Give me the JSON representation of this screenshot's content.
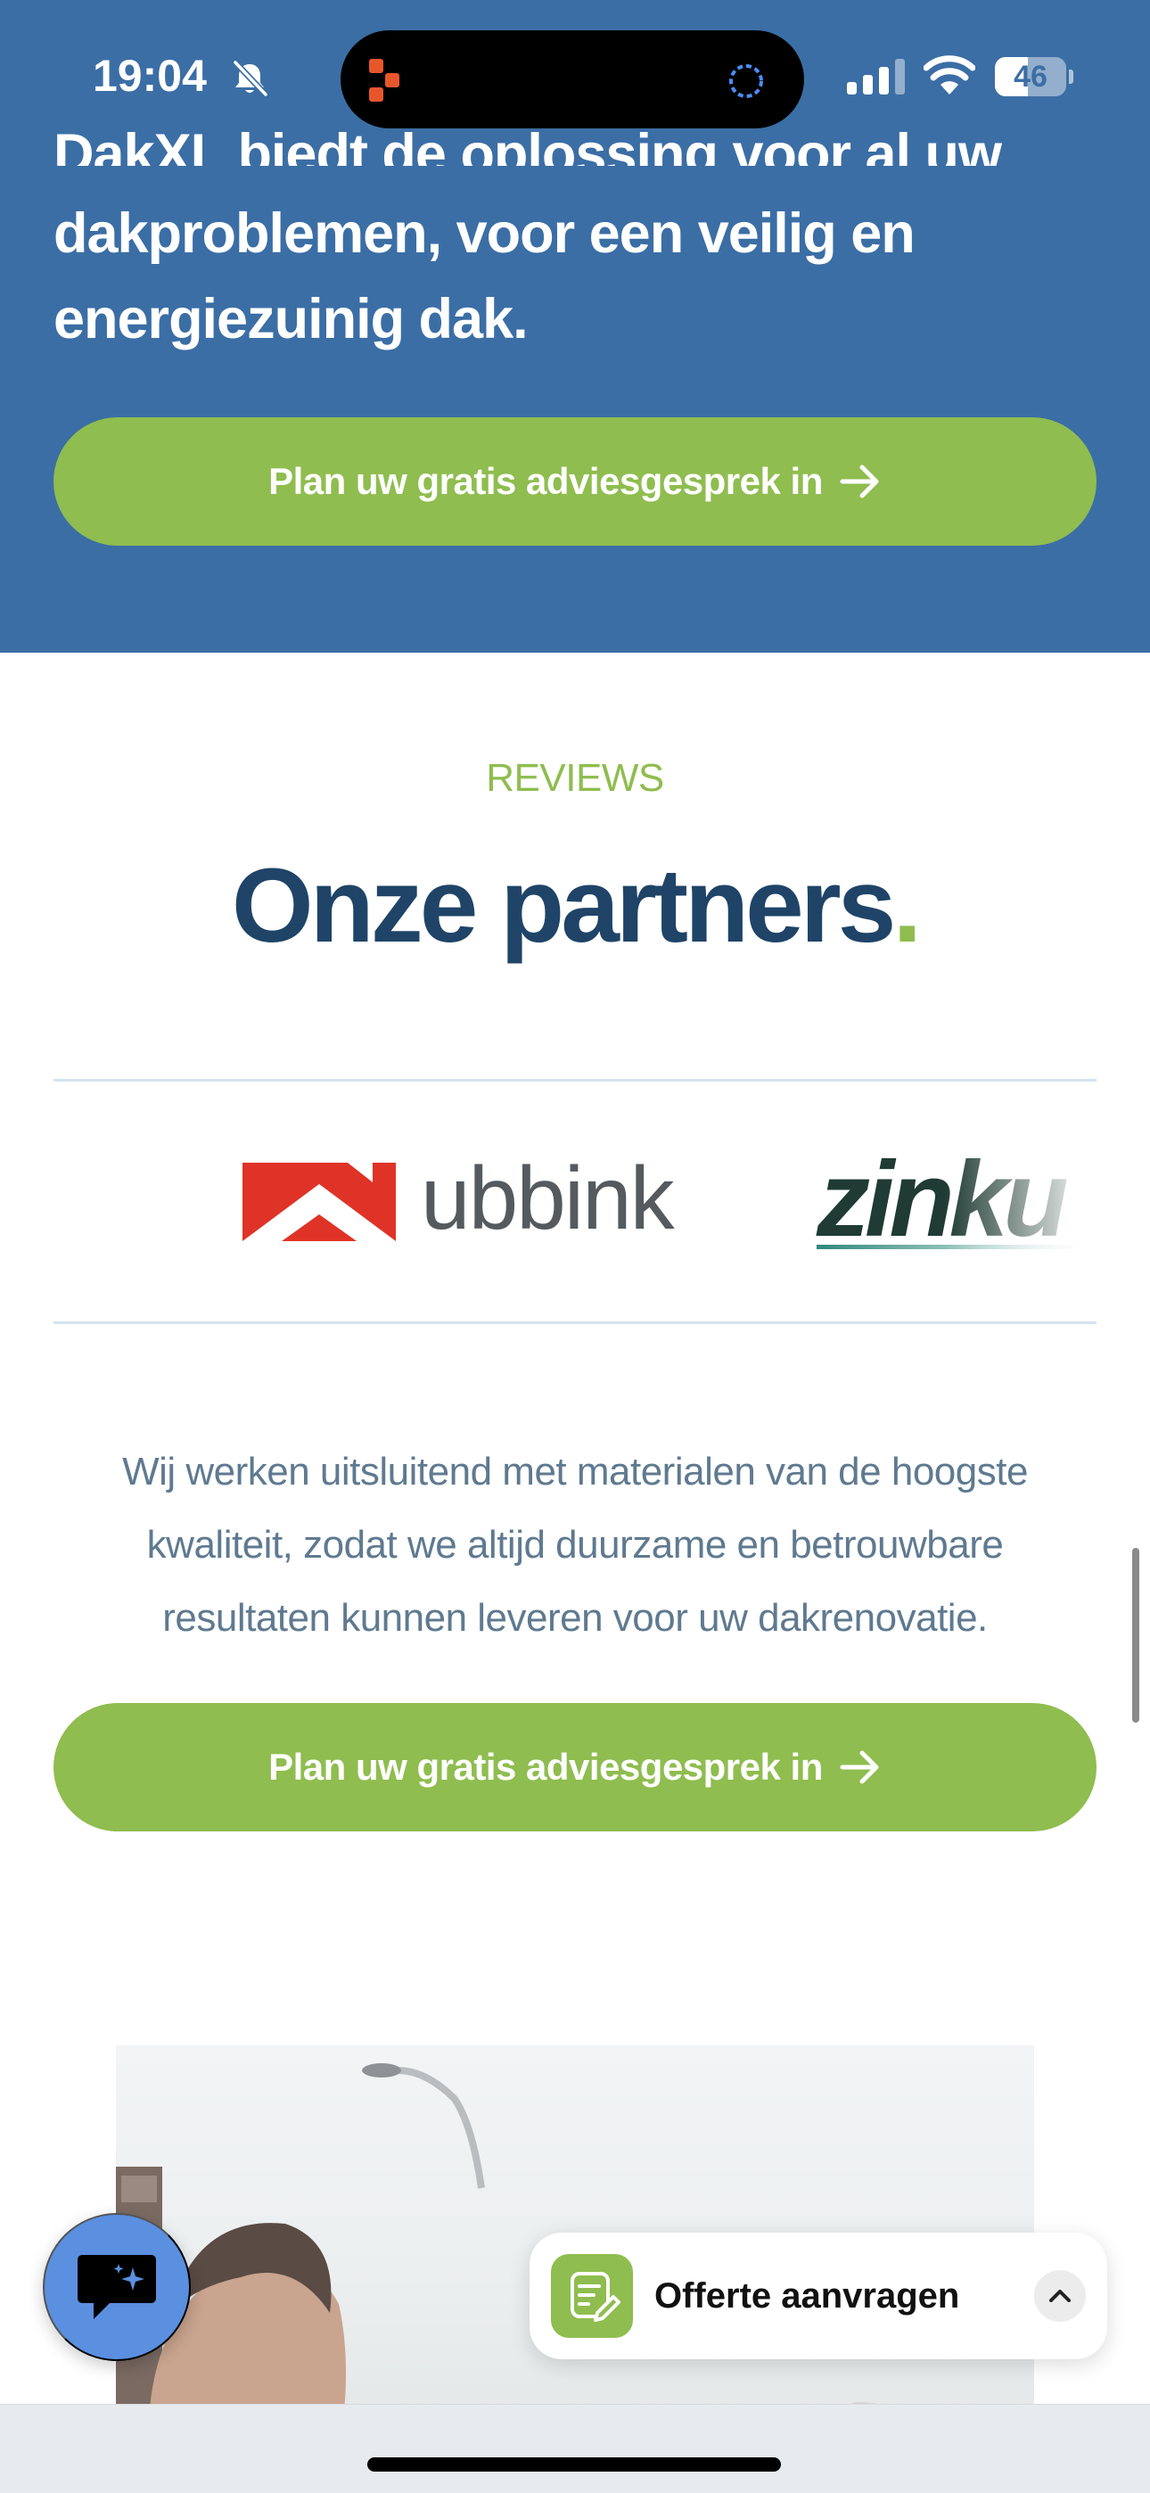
{
  "status_bar": {
    "time": "19:04",
    "battery": "46",
    "battery_level": 0.46
  },
  "hero": {
    "cut_text": "DakXL biedt de oplossing voor al uw",
    "text_lines": [
      "dakproblemen, voor een veilig en",
      "energiezuinig dak."
    ],
    "cta_label": "Plan uw gratis adviesgesprek in"
  },
  "partners": {
    "eyebrow": "REVIEWS",
    "title": "Onze partners",
    "title_dot": ".",
    "logos": [
      "ubbink",
      "zinku"
    ],
    "body_lines": [
      "Wij werken uitsluitend met materialen van de hoogste",
      "kwaliteit, zodat we altijd duurzame en betrouwbare",
      "resultaten kunnen leveren voor uw dakrenovatie."
    ],
    "cta_label": "Plan uw gratis adviesgesprek in"
  },
  "widgets": {
    "offerte_label": "Offerte aanvragen",
    "chat_icon": "chat-sparkle-icon",
    "offerte_icon": "form-edit-icon",
    "toggle_icon": "chevron-up-icon"
  },
  "colors": {
    "hero_bg": "#3b6ea5",
    "accent_green": "#8fbd4f",
    "title_navy": "#1f4468",
    "body_text": "#5f7a90",
    "chat_blue": "#5b8fe0"
  }
}
